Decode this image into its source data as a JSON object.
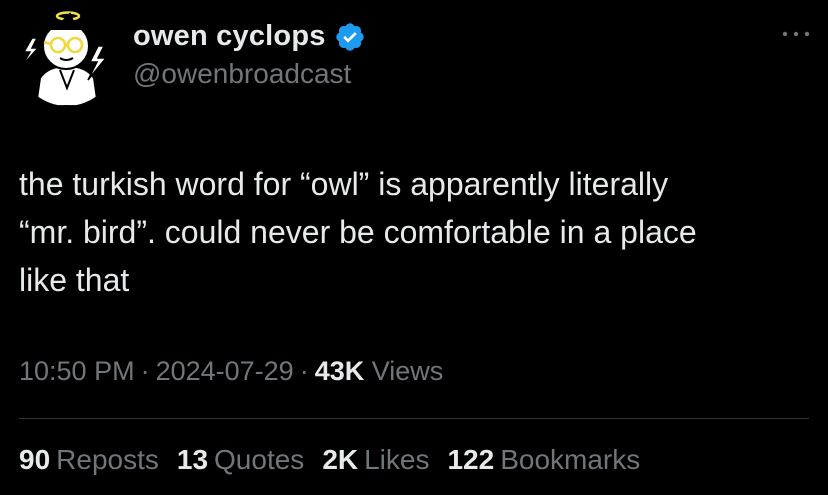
{
  "author": {
    "display_name": "owen cyclops",
    "handle": "@owenbroadcast",
    "verified": true,
    "verified_color": "#1d9bf0",
    "avatar_icon": "cartoon-cyclops-avatar-icon"
  },
  "tweet": {
    "text": "the turkish word for “owl” is apparently literally\n“mr. bird”. could never be comfortable in a place\nlike that"
  },
  "meta": {
    "time": "10:50 PM",
    "separator": "·",
    "date": "2024-07-29",
    "views_count": "43K",
    "views_label": "Views"
  },
  "stats": {
    "reposts": {
      "count": "90",
      "label": "Reposts"
    },
    "quotes": {
      "count": "13",
      "label": "Quotes"
    },
    "likes": {
      "count": "2K",
      "label": "Likes"
    },
    "bookmarks": {
      "count": "122",
      "label": "Bookmarks"
    }
  },
  "colors": {
    "background": "#000000",
    "primary_text": "#e7e9ea",
    "secondary_text": "#71767b",
    "divider": "#2f3336"
  }
}
